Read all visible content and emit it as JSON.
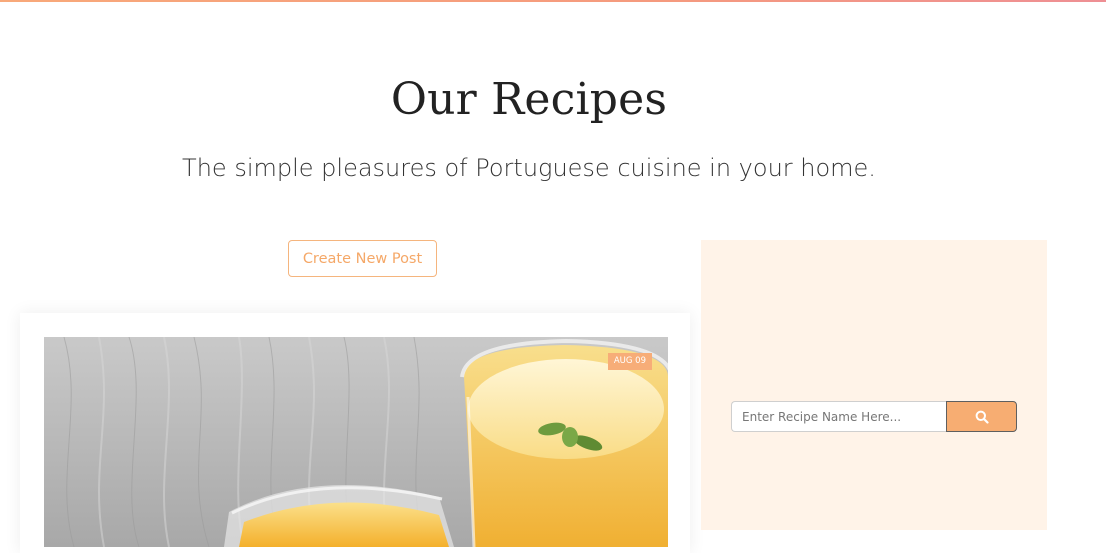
{
  "header": {
    "title": "Our Recipes",
    "subtitle": "The simple pleasures of Portuguese cuisine in your home."
  },
  "actions": {
    "create_label": "Create New Post"
  },
  "posts": [
    {
      "date_badge": "AUG 09",
      "image": "orange-smoothie-glasses-photo"
    }
  ],
  "search": {
    "placeholder": "Enter Recipe Name Here...",
    "button_icon": "search-icon"
  },
  "colors": {
    "accent": "#f7ad72",
    "sidebar_bg": "#fff3e8",
    "title_text": "#222222"
  }
}
